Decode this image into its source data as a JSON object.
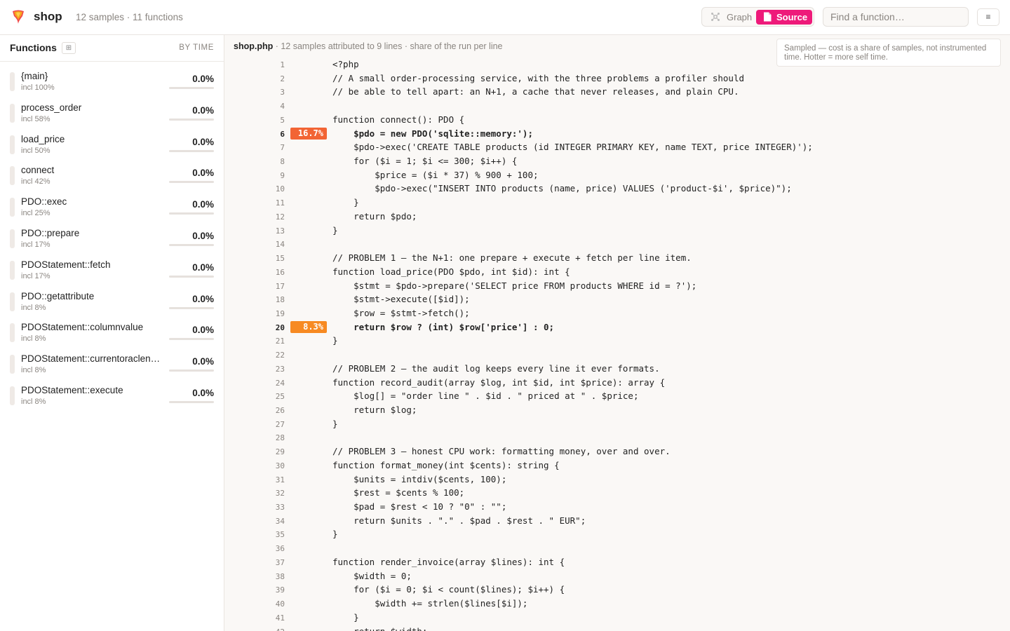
{
  "app": {
    "title": "shop",
    "summary": "12 samples · 11 functions"
  },
  "view_toggle": {
    "graph_label": "Graph",
    "source_label": "Source",
    "active": "Source",
    "graph_icon": "graph-icon",
    "source_icon": "file-icon"
  },
  "search": {
    "placeholder": "Find a function…",
    "value": ""
  },
  "menu": {
    "icon": "≡"
  },
  "colors": {
    "accent": "#ee1a7a",
    "heat_high": "#f26434",
    "heat_mid": "#f78a22"
  },
  "sidebar": {
    "title": "Functions",
    "toggle_icon": "⊞",
    "sort_label": "BY TIME",
    "functions": [
      {
        "name": "{main}",
        "incl": "incl 100%",
        "pct": "0.0%",
        "fraction": 0
      },
      {
        "name": "process_order",
        "incl": "incl 58%",
        "pct": "0.0%",
        "fraction": 0
      },
      {
        "name": "load_price",
        "incl": "incl 50%",
        "pct": "0.0%",
        "fraction": 0
      },
      {
        "name": "connect",
        "incl": "incl 42%",
        "pct": "0.0%",
        "fraction": 0
      },
      {
        "name": "PDO::exec",
        "incl": "incl 25%",
        "pct": "0.0%",
        "fraction": 0
      },
      {
        "name": "PDO::prepare",
        "incl": "incl 17%",
        "pct": "0.0%",
        "fraction": 0
      },
      {
        "name": "PDOStatement::fetch",
        "incl": "incl 17%",
        "pct": "0.0%",
        "fraction": 0
      },
      {
        "name": "PDO::getattribute",
        "incl": "incl 8%",
        "pct": "0.0%",
        "fraction": 0
      },
      {
        "name": "PDOStatement::columnvalue",
        "incl": "incl 8%",
        "pct": "0.0%",
        "fraction": 0
      },
      {
        "name": "PDOStatement::currentoraclen…",
        "incl": "incl 8%",
        "pct": "0.0%",
        "fraction": 0
      },
      {
        "name": "PDOStatement::execute",
        "incl": "incl 8%",
        "pct": "0.0%",
        "fraction": 0
      }
    ]
  },
  "source": {
    "file_name": "shop.php",
    "file_meta": " · 12 samples attributed to 9 lines · share of the run per line",
    "note": "Sampled — cost is a share of samples, not instrumented time. Hotter = more self time.",
    "lines": [
      {
        "n": "1",
        "text": "<?php"
      },
      {
        "n": "2",
        "text": "// A small order-processing service, with the three problems a profiler should"
      },
      {
        "n": "3",
        "text": "// be able to tell apart: an N+1, a cache that never releases, and plain CPU."
      },
      {
        "n": "4",
        "text": ""
      },
      {
        "n": "5",
        "text": "function connect(): PDO {"
      },
      {
        "n": "6",
        "text": "    $pdo = new PDO('sqlite::memory:');",
        "heat": "16.7%",
        "level": "high"
      },
      {
        "n": "7",
        "text": "    $pdo->exec('CREATE TABLE products (id INTEGER PRIMARY KEY, name TEXT, price INTEGER)');"
      },
      {
        "n": "8",
        "text": "    for ($i = 1; $i <= 300; $i++) {"
      },
      {
        "n": "9",
        "text": "        $price = ($i * 37) % 900 + 100;"
      },
      {
        "n": "10",
        "text": "        $pdo->exec(\"INSERT INTO products (name, price) VALUES ('product-$i', $price)\");"
      },
      {
        "n": "11",
        "text": "    }"
      },
      {
        "n": "12",
        "text": "    return $pdo;"
      },
      {
        "n": "13",
        "text": "}"
      },
      {
        "n": "14",
        "text": ""
      },
      {
        "n": "15",
        "text": "// PROBLEM 1 — the N+1: one prepare + execute + fetch per line item."
      },
      {
        "n": "16",
        "text": "function load_price(PDO $pdo, int $id): int {"
      },
      {
        "n": "17",
        "text": "    $stmt = $pdo->prepare('SELECT price FROM products WHERE id = ?');"
      },
      {
        "n": "18",
        "text": "    $stmt->execute([$id]);"
      },
      {
        "n": "19",
        "text": "    $row = $stmt->fetch();"
      },
      {
        "n": "20",
        "text": "    return $row ? (int) $row['price'] : 0;",
        "heat": "8.3%",
        "level": "mid"
      },
      {
        "n": "21",
        "text": "}"
      },
      {
        "n": "22",
        "text": ""
      },
      {
        "n": "23",
        "text": "// PROBLEM 2 — the audit log keeps every line it ever formats."
      },
      {
        "n": "24",
        "text": "function record_audit(array $log, int $id, int $price): array {"
      },
      {
        "n": "25",
        "text": "    $log[] = \"order line \" . $id . \" priced at \" . $price;"
      },
      {
        "n": "26",
        "text": "    return $log;"
      },
      {
        "n": "27",
        "text": "}"
      },
      {
        "n": "28",
        "text": ""
      },
      {
        "n": "29",
        "text": "// PROBLEM 3 — honest CPU work: formatting money, over and over."
      },
      {
        "n": "30",
        "text": "function format_money(int $cents): string {"
      },
      {
        "n": "31",
        "text": "    $units = intdiv($cents, 100);"
      },
      {
        "n": "32",
        "text": "    $rest = $cents % 100;"
      },
      {
        "n": "33",
        "text": "    $pad = $rest < 10 ? \"0\" : \"\";"
      },
      {
        "n": "34",
        "text": "    return $units . \".\" . $pad . $rest . \" EUR\";"
      },
      {
        "n": "35",
        "text": "}"
      },
      {
        "n": "36",
        "text": ""
      },
      {
        "n": "37",
        "text": "function render_invoice(array $lines): int {"
      },
      {
        "n": "38",
        "text": "    $width = 0;"
      },
      {
        "n": "39",
        "text": "    for ($i = 0; $i < count($lines); $i++) {"
      },
      {
        "n": "40",
        "text": "        $width += strlen($lines[$i]);"
      },
      {
        "n": "41",
        "text": "    }"
      },
      {
        "n": "42",
        "text": "    return $width;"
      }
    ]
  }
}
